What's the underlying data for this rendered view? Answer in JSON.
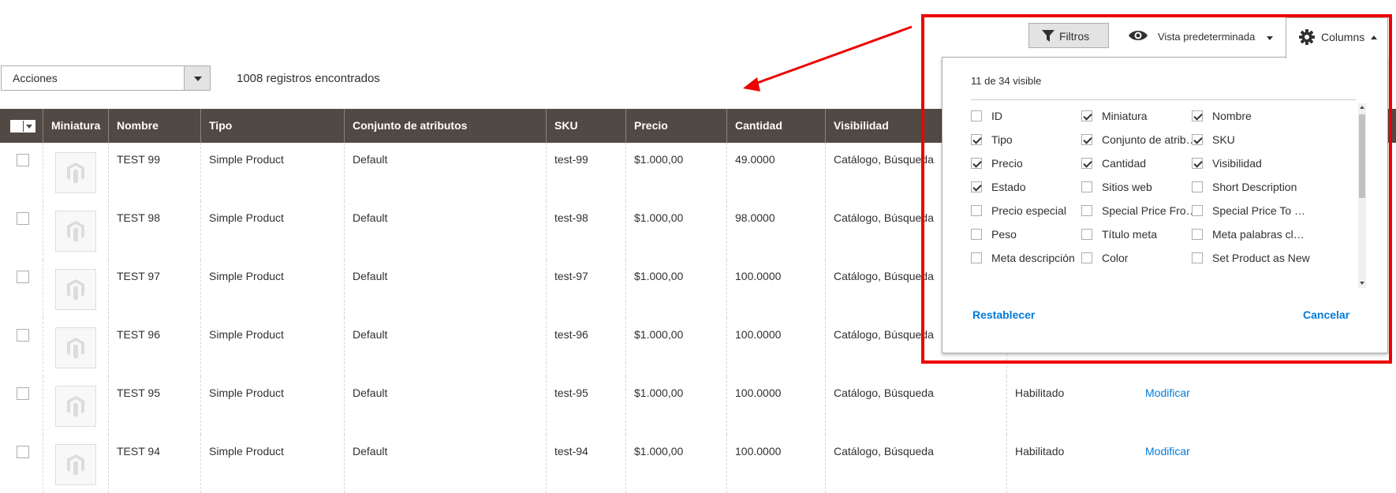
{
  "toolbar": {
    "actions_label": "Acciones",
    "records_text": "1008 registros encontrados",
    "filters_label": "Filtros",
    "view_label": "Vista predeterminada",
    "columns_label": "Columns"
  },
  "grid": {
    "columns": [
      "Miniatura",
      "Nombre",
      "Tipo",
      "Conjunto de atributos",
      "SKU",
      "Precio",
      "Cantidad",
      "Visibilidad"
    ],
    "rows": [
      {
        "name": "TEST 99",
        "type": "Simple Product",
        "set": "Default",
        "sku": "test-99",
        "price": "$1.000,00",
        "qty": "49.0000",
        "visibility": "Catálogo, Búsqueda"
      },
      {
        "name": "TEST 98",
        "type": "Simple Product",
        "set": "Default",
        "sku": "test-98",
        "price": "$1.000,00",
        "qty": "98.0000",
        "visibility": "Catálogo, Búsqueda"
      },
      {
        "name": "TEST 97",
        "type": "Simple Product",
        "set": "Default",
        "sku": "test-97",
        "price": "$1.000,00",
        "qty": "100.0000",
        "visibility": "Catálogo, Búsqueda"
      },
      {
        "name": "TEST 96",
        "type": "Simple Product",
        "set": "Default",
        "sku": "test-96",
        "price": "$1.000,00",
        "qty": "100.0000",
        "visibility": "Catálogo, Búsqueda"
      },
      {
        "name": "TEST 95",
        "type": "Simple Product",
        "set": "Default",
        "sku": "test-95",
        "price": "$1.000,00",
        "qty": "100.0000",
        "visibility": "Catálogo, Búsqueda",
        "status": "Habilitado",
        "action": "Modificar"
      },
      {
        "name": "TEST 94",
        "type": "Simple Product",
        "set": "Default",
        "sku": "test-94",
        "price": "$1.000,00",
        "qty": "100.0000",
        "visibility": "Catálogo, Búsqueda",
        "status": "Habilitado",
        "action": "Modificar"
      }
    ]
  },
  "columns_panel": {
    "count_text": "11 de 34 visible",
    "options": [
      {
        "label": "ID",
        "checked": false
      },
      {
        "label": "Miniatura",
        "checked": true
      },
      {
        "label": "Nombre",
        "checked": true
      },
      {
        "label": "Tipo",
        "checked": true
      },
      {
        "label": "Conjunto de atributos",
        "checked": true
      },
      {
        "label": "SKU",
        "checked": true
      },
      {
        "label": "Precio",
        "checked": true
      },
      {
        "label": "Cantidad",
        "checked": true
      },
      {
        "label": "Visibilidad",
        "checked": true
      },
      {
        "label": "Estado",
        "checked": true
      },
      {
        "label": "Sitios web",
        "checked": false
      },
      {
        "label": "Short Description",
        "checked": false
      },
      {
        "label": "Precio especial",
        "checked": false
      },
      {
        "label": "Special Price From Date",
        "checked": false
      },
      {
        "label": "Special Price To Date",
        "checked": false
      },
      {
        "label": "Peso",
        "checked": false
      },
      {
        "label": "Título meta",
        "checked": false
      },
      {
        "label": "Meta palabras clave",
        "checked": false
      },
      {
        "label": "Meta descripción",
        "checked": false
      },
      {
        "label": "Color",
        "checked": false
      },
      {
        "label": "Set Product as New",
        "checked": false
      }
    ],
    "reset_label": "Restablecer",
    "cancel_label": "Cancelar"
  },
  "colors": {
    "header_bg": "#514943",
    "link": "#007bdb",
    "annotation": "#ee0000"
  }
}
